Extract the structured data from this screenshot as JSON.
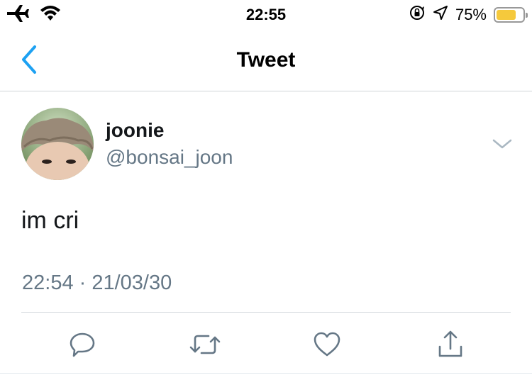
{
  "status_bar": {
    "time": "22:55",
    "battery_percent": "75%",
    "battery_level": 0.75,
    "battery_color": "#f5c93c",
    "icons": [
      "airplane-icon",
      "wifi-icon",
      "orientation-lock-icon",
      "location-arrow-icon",
      "battery-icon"
    ]
  },
  "nav": {
    "title": "Tweet",
    "back_icon": "chevron-left-icon",
    "accent_color": "#1da1f2"
  },
  "tweet": {
    "display_name": "joonie",
    "handle": "@bonsai_joon",
    "text": "im cri",
    "timestamp": "22:54 · 21/03/30",
    "menu_icon": "chevron-down-icon"
  },
  "actions": [
    {
      "name": "reply",
      "icon": "reply-icon"
    },
    {
      "name": "retweet",
      "icon": "retweet-icon"
    },
    {
      "name": "like",
      "icon": "heart-icon"
    },
    {
      "name": "share",
      "icon": "share-icon"
    }
  ],
  "colors": {
    "text_primary": "#14171a",
    "text_secondary": "#657786",
    "icon_gray": "#657786"
  }
}
